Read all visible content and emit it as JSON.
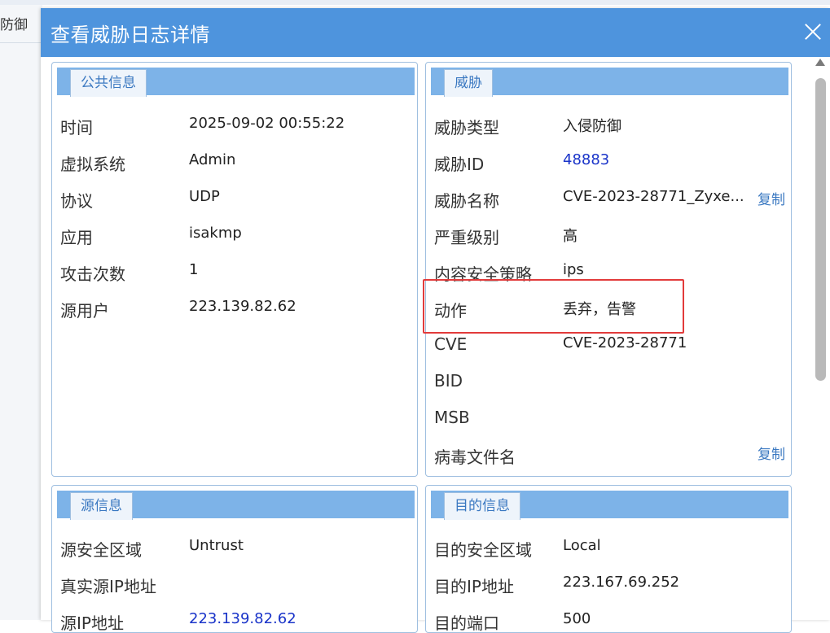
{
  "background": {
    "partial_text": "防御"
  },
  "dialog": {
    "title": "查看威胁日志详情"
  },
  "public_info": {
    "tab": "公共信息",
    "rows": [
      {
        "label": "时间",
        "value": "2025-09-02 00:55:22"
      },
      {
        "label": "虚拟系统",
        "value": "Admin"
      },
      {
        "label": "协议",
        "value": "UDP"
      },
      {
        "label": "应用",
        "value": "isakmp"
      },
      {
        "label": "攻击次数",
        "value": "1"
      },
      {
        "label": "源用户",
        "value": "223.139.82.62"
      }
    ]
  },
  "threat": {
    "tab": "威胁",
    "copy_label": "复制",
    "rows": [
      {
        "label": "威胁类型",
        "value": "入侵防御"
      },
      {
        "label": "威胁ID",
        "value": "48883"
      },
      {
        "label": "威胁名称",
        "value": "CVE-2023-28771_Zyxe..."
      },
      {
        "label": "严重级别",
        "value": "高"
      },
      {
        "label": "内容安全策略",
        "value": "ips"
      },
      {
        "label": "动作",
        "value": "丢弃，告警"
      },
      {
        "label": "CVE",
        "value": "CVE-2023-28771"
      },
      {
        "label": "BID",
        "value": ""
      },
      {
        "label": "MSB",
        "value": ""
      },
      {
        "label": "病毒文件名",
        "value": ""
      }
    ]
  },
  "source_info": {
    "tab": "源信息",
    "rows": [
      {
        "label": "源安全区域",
        "value": "Untrust"
      },
      {
        "label": "真实源IP地址",
        "value": ""
      },
      {
        "label": "源IP地址",
        "value": "223.139.82.62"
      }
    ]
  },
  "dest_info": {
    "tab": "目的信息",
    "rows": [
      {
        "label": "目的安全区域",
        "value": "Local"
      },
      {
        "label": "目的IP地址",
        "value": "223.167.69.252"
      },
      {
        "label": "目的端口",
        "value": "500"
      }
    ]
  },
  "colors": {
    "header": "#4e94dd",
    "panel_header": "#7db3e8",
    "link": "#1a34c9",
    "highlight": "#e23b3b"
  }
}
